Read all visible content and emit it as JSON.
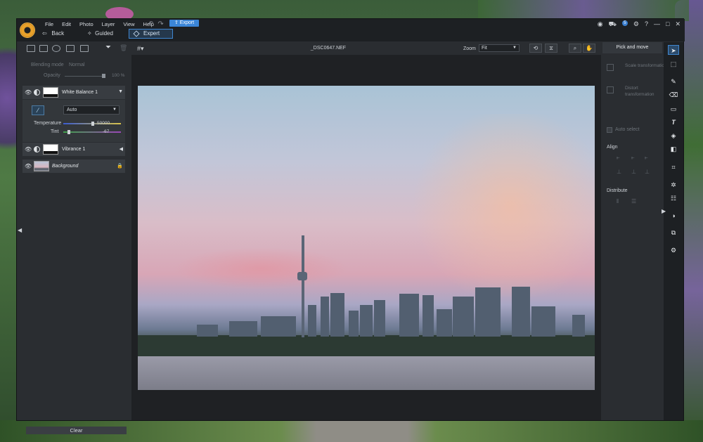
{
  "menu": [
    "File",
    "Edit",
    "Photo",
    "Layer",
    "View",
    "Help"
  ],
  "toolbar": {
    "export_label": "Export",
    "back_label": "Back",
    "guided_label": "Guided",
    "expert_label": "Expert"
  },
  "window_controls": {
    "notifications_count": "5",
    "help": "?",
    "minimize": "—",
    "maximize": "□",
    "close": "✕"
  },
  "left_panel": {
    "blending_mode_label": "Blending mode",
    "blending_mode_value": "Normal",
    "opacity_label": "Opacity",
    "opacity_value": "100 %",
    "layers": [
      {
        "name": "White Balance 1",
        "expanded": true
      },
      {
        "name": "Vibrance 1",
        "expanded": false
      },
      {
        "name": "Background",
        "locked": true
      }
    ],
    "white_balance": {
      "mode_value": "Auto",
      "temperature_label": "Temperature",
      "temperature_value": "50000",
      "tint_label": "Tint",
      "tint_value": "-67"
    },
    "clear_label": "Clear"
  },
  "center": {
    "filename": "_DSC0647.NEF",
    "zoom_label": "Zoom",
    "zoom_value": "Fit"
  },
  "right_panel": {
    "header": "Pick and move",
    "scale_label": "Scale transformation",
    "distort_label": "Distort transformation",
    "auto_select_label": "Auto select",
    "align_label": "Align",
    "distribute_label": "Distribute"
  },
  "colors": {
    "accent": "#3b86d8",
    "panel": "#2a2d31",
    "titlebar": "#1d2023"
  }
}
